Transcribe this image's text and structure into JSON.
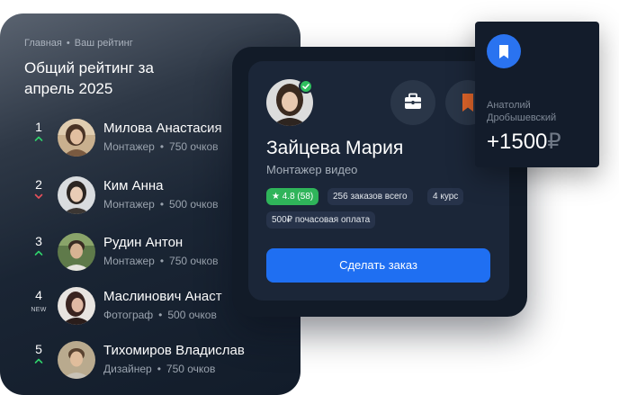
{
  "breadcrumb": {
    "home": "Главная",
    "current": "Ваш рейтинг"
  },
  "panel": {
    "title": "Общий рейтинг за апрель 2025"
  },
  "ranking": [
    {
      "rank": "1",
      "trend": "up",
      "trend_label": "",
      "name": "Милова Анастасия",
      "role": "Монтажер",
      "points": "750 очков"
    },
    {
      "rank": "2",
      "trend": "down",
      "trend_label": "",
      "name": "Ким Анна",
      "role": "Монтажер",
      "points": "500 очков"
    },
    {
      "rank": "3",
      "trend": "up",
      "trend_label": "",
      "name": "Рудин Антон",
      "role": "Монтажер",
      "points": "750 очков"
    },
    {
      "rank": "4",
      "trend": "new",
      "trend_label": "NEW",
      "name": "Маслинович Анаст",
      "role": "Фотограф",
      "points": "500 очков"
    },
    {
      "rank": "5",
      "trend": "up",
      "trend_label": "",
      "name": "Тихомиров Владислав",
      "role": "Дизайнер",
      "points": "750 очков"
    }
  ],
  "separator": "•",
  "profile": {
    "name": "Зайцева Мария",
    "role": "Монтажер видео",
    "rating": "4.8 (58)",
    "orders": "256 заказов всего",
    "course": "4 курс",
    "rate": "500₽ почасовая оплата",
    "order_button": "Сделать заказ"
  },
  "payment": {
    "name": "Анатолий Дробышевский",
    "amount": "+1500",
    "currency": "₽"
  },
  "icons": {
    "trend_up": "chevron-up-icon",
    "trend_down": "chevron-down-icon",
    "verified": "check-icon",
    "briefcase": "briefcase-icon",
    "bookmark": "bookmark-icon",
    "star": "star-icon"
  },
  "colors": {
    "accent": "#1f6ff2",
    "success": "#2fb45a",
    "trend_up": "#2fd16b",
    "trend_down": "#e8505b",
    "bookmark": "#e0652a"
  }
}
